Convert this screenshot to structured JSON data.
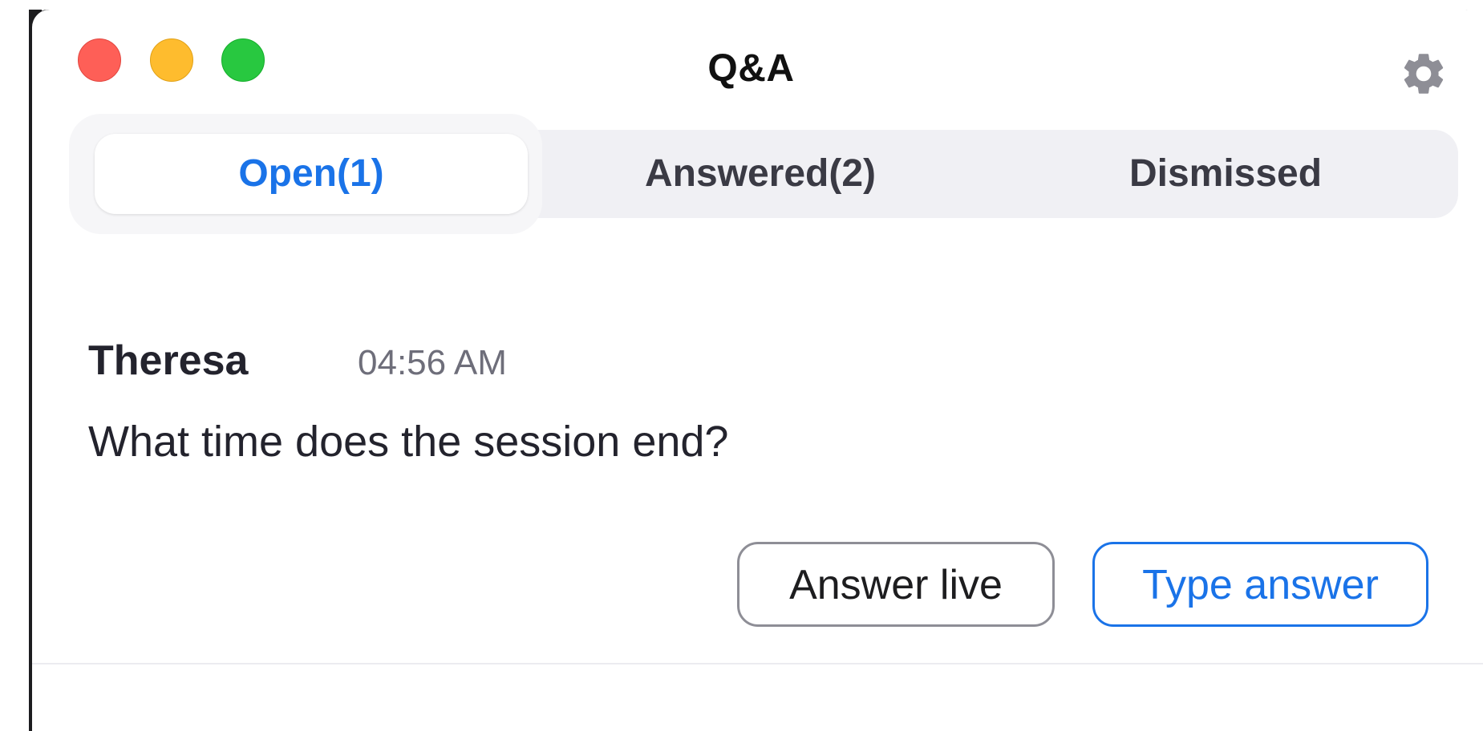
{
  "window": {
    "title": "Q&A",
    "settings_icon": "gear-icon"
  },
  "tabs": [
    {
      "label": "Open(1)",
      "selected": true
    },
    {
      "label": "Answered(2)",
      "selected": false
    },
    {
      "label": "Dismissed",
      "selected": false
    }
  ],
  "question": {
    "author": "Theresa",
    "time": "04:56 AM",
    "text": "What time does the session end?",
    "actions": {
      "answer_live": "Answer live",
      "type_answer": "Type answer"
    }
  },
  "colors": {
    "accent": "#1a73e8",
    "close": "#fe5f57",
    "minimize": "#febc2e",
    "zoom": "#28c840"
  }
}
